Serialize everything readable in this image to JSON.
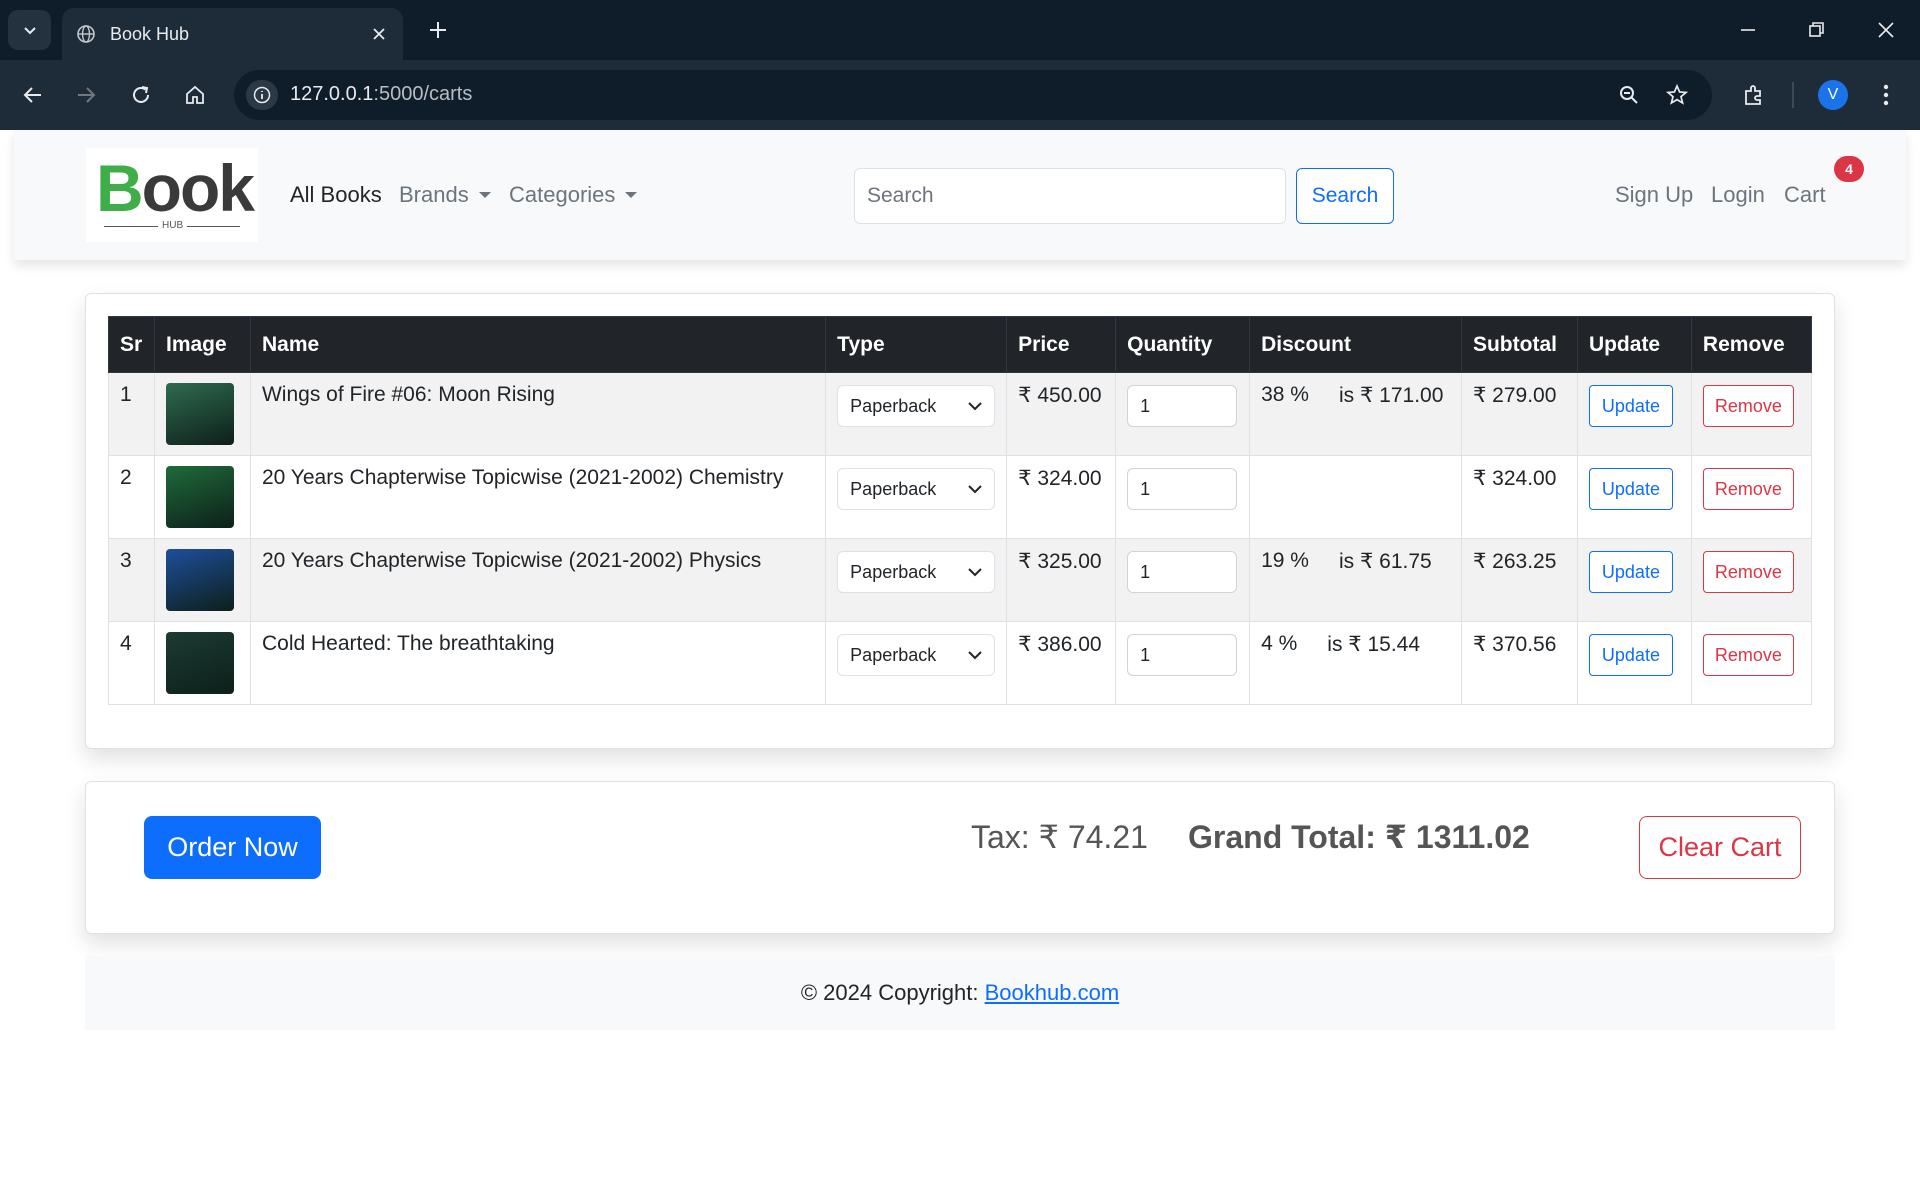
{
  "browser": {
    "tab_title": "Book Hub",
    "url_host": "127.0.0.1",
    "url_path": ":5000/carts",
    "profile_initial": "V"
  },
  "navbar": {
    "logo_text_b": "B",
    "logo_text_rest": "ook",
    "logo_sub": "HUB",
    "links": {
      "all_books": "All Books",
      "brands": "Brands",
      "categories": "Categories"
    },
    "search_placeholder": "Search",
    "search_button": "Search",
    "sign_up": "Sign Up",
    "login": "Login",
    "cart": "Cart",
    "cart_count": "4"
  },
  "cart": {
    "headers": [
      "Sr",
      "Image",
      "Name",
      "Type",
      "Price",
      "Quantity",
      "Discount",
      "Subtotal",
      "Update",
      "Remove"
    ],
    "rows": [
      {
        "sr": "1",
        "name": "Wings of Fire #06: Moon Rising",
        "type": "Paperback",
        "price": "₹ 450.00",
        "qty": "1",
        "disc_pct": "38 %",
        "disc_amt": "is ₹ 171.00",
        "subtotal": "₹ 279.00",
        "update": "Update",
        "remove": "Remove",
        "thumb_color": "#2f6b4f"
      },
      {
        "sr": "2",
        "name": "20 Years Chapterwise Topicwise (2021-2002) Chemistry",
        "type": "Paperback",
        "price": "₹ 324.00",
        "qty": "1",
        "disc_pct": "",
        "disc_amt": "",
        "subtotal": "₹ 324.00",
        "update": "Update",
        "remove": "Remove",
        "thumb_color": "#1f6b3a"
      },
      {
        "sr": "3",
        "name": "20 Years Chapterwise Topicwise (2021-2002) Physics",
        "type": "Paperback",
        "price": "₹ 325.00",
        "qty": "1",
        "disc_pct": "19 %",
        "disc_amt": "is ₹ 61.75",
        "subtotal": "₹ 263.25",
        "update": "Update",
        "remove": "Remove",
        "thumb_color": "#1d4f9c"
      },
      {
        "sr": "4",
        "name": "Cold Hearted: The breathtaking",
        "type": "Paperback",
        "price": "₹ 386.00",
        "qty": "1",
        "disc_pct": "4 %",
        "disc_amt": "is ₹ 15.44",
        "subtotal": "₹ 370.56",
        "update": "Update",
        "remove": "Remove",
        "thumb_color": "#1c3b33"
      }
    ]
  },
  "totals": {
    "order_button": "Order Now",
    "tax": "Tax: ₹ 74.21",
    "grand_total": "Grand Total: ₹ 1311.02",
    "clear_button": "Clear Cart"
  },
  "footer": {
    "copyright": "© 2024 Copyright:",
    "link": "Bookhub.com"
  }
}
